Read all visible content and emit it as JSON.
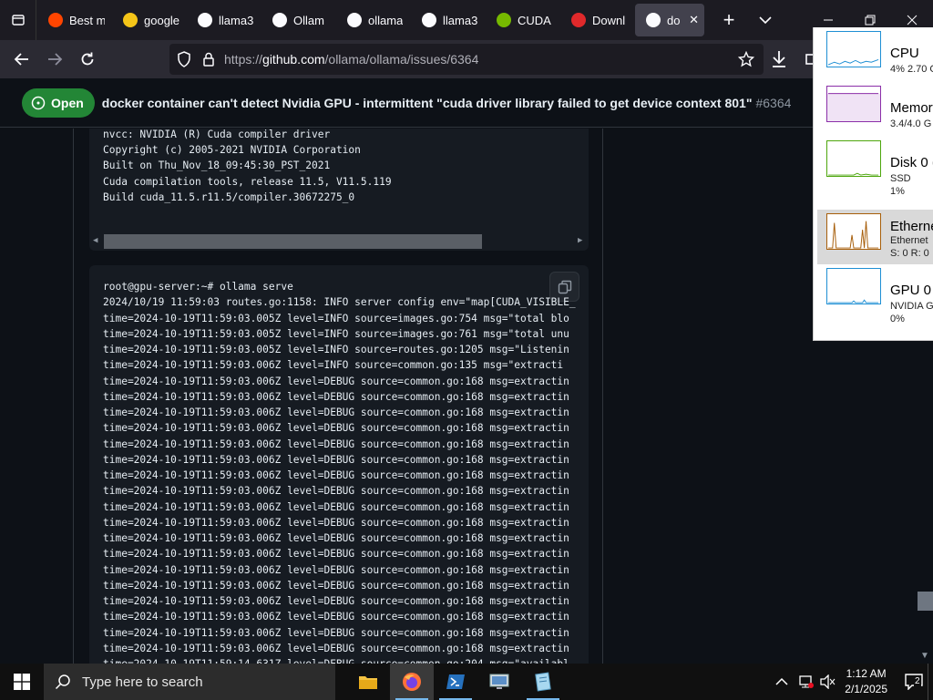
{
  "tabs": [
    {
      "label": "Best m",
      "icon": "reddit-icon",
      "color": "#ff4500"
    },
    {
      "label": "google",
      "icon": "emoji-icon",
      "color": "#f5c518"
    },
    {
      "label": "llama3",
      "icon": "ollama-icon",
      "color": "#ffffff"
    },
    {
      "label": "Ollam",
      "icon": "page-icon",
      "color": "#ffffff"
    },
    {
      "label": "ollama",
      "icon": "github-icon",
      "color": "#ffffff"
    },
    {
      "label": "llama3",
      "icon": "ollama-icon",
      "color": "#ffffff"
    },
    {
      "label": "CUDA",
      "icon": "nvidia-icon",
      "color": "#76b900"
    },
    {
      "label": "Downl",
      "icon": "power-icon",
      "color": "#e0292b"
    },
    {
      "label": "dock",
      "icon": "github-icon",
      "color": "#ffffff",
      "active": true
    }
  ],
  "navbar": {
    "url_prefix": "https://",
    "url_host": "github.com",
    "url_path": "/ollama/ollama/issues/6364"
  },
  "issue": {
    "status": "Open",
    "title": "docker container can't detect Nvidia GPU - intermittent \"cuda driver library failed to get device context 801\"",
    "number": "#6364"
  },
  "code1": [
    "nvcc: NVIDIA (R) Cuda compiler driver",
    "Copyright (c) 2005-2021 NVIDIA Corporation",
    "Built on Thu_Nov_18_09:45:30_PST_2021",
    "Cuda compilation tools, release 11.5, V11.5.119",
    "Build cuda_11.5.r11.5/compiler.30672275_0"
  ],
  "code2": [
    "root@gpu-server:~# ollama serve",
    "2024/10/19 11:59:03 routes.go:1158: INFO server config env=\"map[CUDA_VISIBLE_",
    "time=2024-10-19T11:59:03.005Z level=INFO source=images.go:754 msg=\"total blo",
    "time=2024-10-19T11:59:03.005Z level=INFO source=images.go:761 msg=\"total unu",
    "time=2024-10-19T11:59:03.005Z level=INFO source=routes.go:1205 msg=\"Listenin",
    "time=2024-10-19T11:59:03.006Z level=INFO source=common.go:135 msg=\"extracti",
    "time=2024-10-19T11:59:03.006Z level=DEBUG source=common.go:168 msg=extractin",
    "time=2024-10-19T11:59:03.006Z level=DEBUG source=common.go:168 msg=extractin",
    "time=2024-10-19T11:59:03.006Z level=DEBUG source=common.go:168 msg=extractin",
    "time=2024-10-19T11:59:03.006Z level=DEBUG source=common.go:168 msg=extractin",
    "time=2024-10-19T11:59:03.006Z level=DEBUG source=common.go:168 msg=extractin",
    "time=2024-10-19T11:59:03.006Z level=DEBUG source=common.go:168 msg=extractin",
    "time=2024-10-19T11:59:03.006Z level=DEBUG source=common.go:168 msg=extractin",
    "time=2024-10-19T11:59:03.006Z level=DEBUG source=common.go:168 msg=extractin",
    "time=2024-10-19T11:59:03.006Z level=DEBUG source=common.go:168 msg=extractin",
    "time=2024-10-19T11:59:03.006Z level=DEBUG source=common.go:168 msg=extractin",
    "time=2024-10-19T11:59:03.006Z level=DEBUG source=common.go:168 msg=extractin",
    "time=2024-10-19T11:59:03.006Z level=DEBUG source=common.go:168 msg=extractin",
    "time=2024-10-19T11:59:03.006Z level=DEBUG source=common.go:168 msg=extractin",
    "time=2024-10-19T11:59:03.006Z level=DEBUG source=common.go:168 msg=extractin",
    "time=2024-10-19T11:59:03.006Z level=DEBUG source=common.go:168 msg=extractin",
    "time=2024-10-19T11:59:03.006Z level=DEBUG source=common.go:168 msg=extractin",
    "time=2024-10-19T11:59:03.006Z level=DEBUG source=common.go:168 msg=extractin",
    "time=2024-10-19T11:59:03.006Z level=DEBUG source=common.go:168 msg=extractin",
    "time=2024-10-19T11:59:14.631Z level=DEBUG source=common.go:204 msg=\"availabl"
  ],
  "taskmgr": [
    {
      "name": "CPU",
      "line1": "4% 2.70 G",
      "line2": "",
      "color": "#1e8fd4"
    },
    {
      "name": "Memory",
      "line1": "3.4/4.0 G",
      "line2": "",
      "color": "#8b2fa8"
    },
    {
      "name": "Disk 0 (",
      "line1": "SSD",
      "line2": "1%",
      "color": "#4da60c"
    },
    {
      "name": "Etherne",
      "line1": "Ethernet",
      "line2": "S: 0 R: 0",
      "color": "#a75e0a"
    },
    {
      "name": "GPU 0",
      "line1": "NVIDIA G",
      "line2": "0%",
      "color": "#1e8fd4"
    }
  ],
  "taskbar": {
    "search_placeholder": "Type here to search",
    "time": "1:12 AM",
    "date": "2/1/2025",
    "notification_count": "2"
  }
}
